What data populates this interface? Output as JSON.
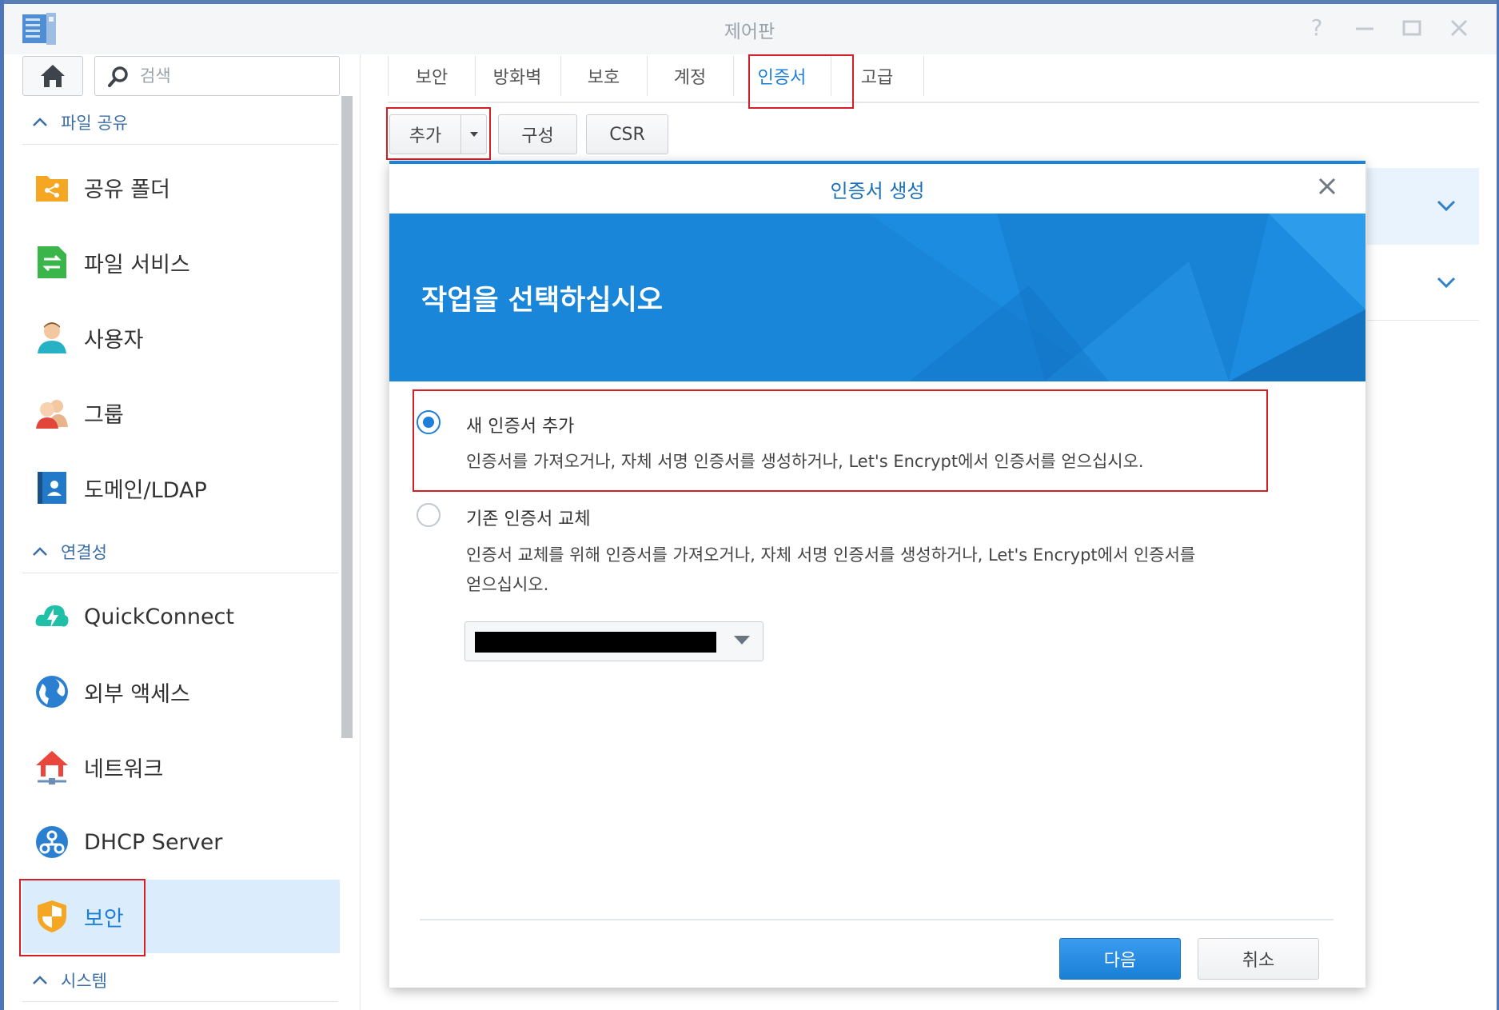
{
  "window": {
    "title": "제어판",
    "controls": [
      "help-icon",
      "minimize-icon",
      "maximize-icon",
      "close-icon"
    ]
  },
  "sidebar": {
    "search_placeholder": "검색",
    "sections": [
      {
        "label": "파일 공유",
        "items": [
          {
            "label": "공유 폴더",
            "icon": "shared-folder-icon"
          },
          {
            "label": "파일 서비스",
            "icon": "file-services-icon"
          },
          {
            "label": "사용자",
            "icon": "user-icon"
          },
          {
            "label": "그룹",
            "icon": "group-icon"
          },
          {
            "label": "도메인/LDAP",
            "icon": "domain-ldap-icon"
          }
        ]
      },
      {
        "label": "연결성",
        "items": [
          {
            "label": "QuickConnect",
            "icon": "quickconnect-icon"
          },
          {
            "label": "외부 액세스",
            "icon": "external-access-icon"
          },
          {
            "label": "네트워크",
            "icon": "network-icon"
          },
          {
            "label": "DHCP Server",
            "icon": "dhcp-server-icon"
          },
          {
            "label": "보안",
            "icon": "security-shield-icon",
            "active": true
          }
        ]
      },
      {
        "label": "시스템",
        "items": []
      }
    ]
  },
  "tabs": [
    {
      "label": "보안"
    },
    {
      "label": "방화벽"
    },
    {
      "label": "보호"
    },
    {
      "label": "계정"
    },
    {
      "label": "인증서",
      "active": true
    },
    {
      "label": "고급"
    }
  ],
  "toolbar": {
    "add_label": "추가",
    "configure_label": "구성",
    "csr_label": "CSR"
  },
  "dialog": {
    "title": "인증서 생성",
    "heading": "작업을 선택하십시오",
    "options": [
      {
        "label": "새 인증서 추가",
        "description": "인증서를 가져오거나, 자체 서명 인증서를 생성하거나, Let's Encrypt에서 인증서를 얻으십시오.",
        "selected": true
      },
      {
        "label": "기존 인증서 교체",
        "description_line1": "인증서 교체를 위해 인증서를 가져오거나, 자체 서명 인증서를 생성하거나, Let's Encrypt에서 인증서를",
        "description_line2": "얻으십시오.",
        "selected": false
      }
    ],
    "next_label": "다음",
    "cancel_label": "취소"
  },
  "colors": {
    "accent": "#1d7fd9",
    "banner": "#1a86d9",
    "highlight_box": "#d41f26",
    "active_item_bg": "#dbedfd"
  }
}
